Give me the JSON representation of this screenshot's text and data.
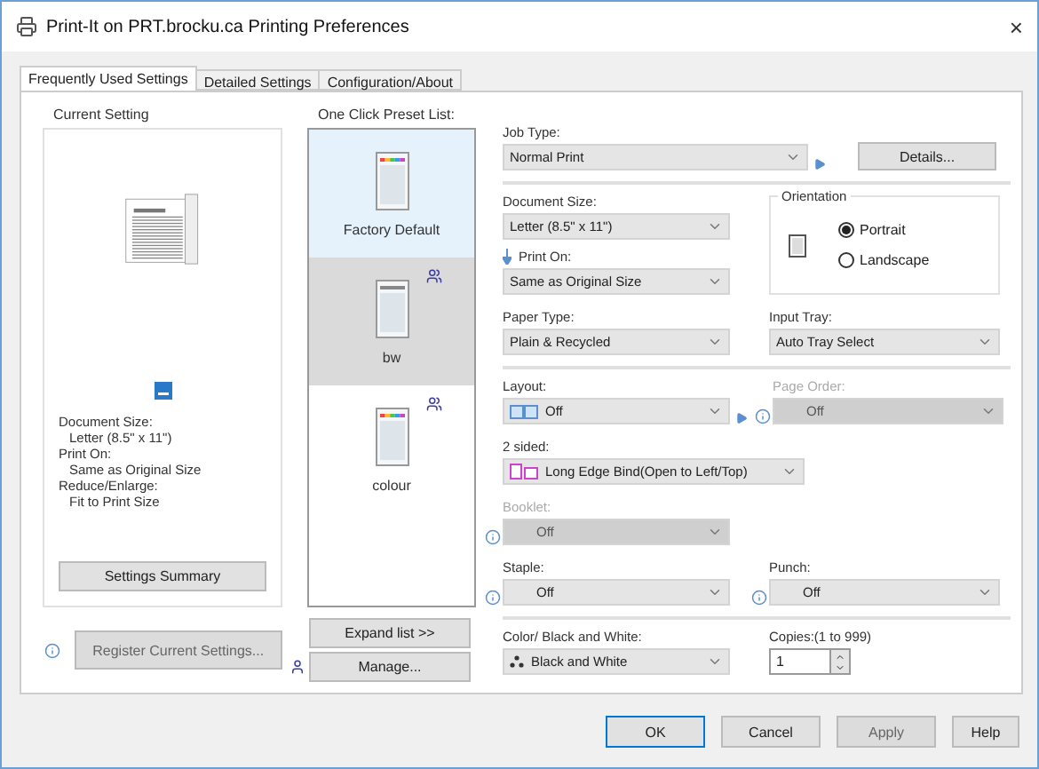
{
  "window": {
    "title": "Print-It on PRT.brocku.ca Printing Preferences",
    "close": "×"
  },
  "tabs": [
    {
      "label": "Frequently Used Settings",
      "selected": true
    },
    {
      "label": "Detailed Settings",
      "selected": false
    },
    {
      "label": "Configuration/About",
      "selected": false
    }
  ],
  "current_setting": {
    "title": "Current Setting",
    "summary": [
      {
        "heading": "Document Size:",
        "value": "Letter (8.5\" x 11\")"
      },
      {
        "heading": "Print On:",
        "value": "Same as Original Size"
      },
      {
        "heading": "Reduce/Enlarge:",
        "value": "Fit to Print Size"
      }
    ],
    "button": "Settings Summary"
  },
  "register_button": {
    "label": "Register Current Settings...",
    "disabled": true
  },
  "preset_list": {
    "title": "One Click Preset List:",
    "items": [
      {
        "label": "Factory Default",
        "selected": false,
        "hovered": true,
        "kind": "color",
        "shared": false
      },
      {
        "label": "bw",
        "selected": true,
        "hovered": false,
        "kind": "mono",
        "shared": true
      },
      {
        "label": "colour",
        "selected": false,
        "hovered": false,
        "kind": "color",
        "shared": true
      }
    ],
    "expand_button": "Expand list >>",
    "manage_button": "Manage..."
  },
  "job_type": {
    "label": "Job Type:",
    "value": "Normal Print",
    "button": "Details..."
  },
  "document_size": {
    "label": "Document Size:",
    "value": "Letter (8.5\" x 11\")"
  },
  "print_on": {
    "label": "Print On:",
    "value": "Same as Original Size"
  },
  "orientation": {
    "title": "Orientation",
    "options": [
      {
        "label": "Portrait",
        "selected": true
      },
      {
        "label": "Landscape",
        "selected": false
      }
    ]
  },
  "paper_type": {
    "label": "Paper Type:",
    "value": "Plain & Recycled"
  },
  "input_tray": {
    "label": "Input Tray:",
    "value": "Auto Tray Select"
  },
  "layout": {
    "label": "Layout:",
    "value": "Off"
  },
  "page_order": {
    "label": "Page Order:",
    "value": "Off",
    "disabled": true
  },
  "two_sided": {
    "label": "2 sided:",
    "value": "Long Edge Bind(Open to Left/Top)"
  },
  "booklet": {
    "label": "Booklet:",
    "value": "Off",
    "disabled": true
  },
  "staple": {
    "label": "Staple:",
    "value": "Off",
    "disabled": false
  },
  "punch": {
    "label": "Punch:",
    "value": "Off",
    "disabled": false
  },
  "color_mode": {
    "label": "Color/ Black and White:",
    "value": "Black and White"
  },
  "copies": {
    "label": "Copies:(1 to 999)",
    "value": "1"
  },
  "dialog_buttons": [
    {
      "label": "OK",
      "disabled": false,
      "default": true
    },
    {
      "label": "Cancel",
      "disabled": false,
      "default": false
    },
    {
      "label": "Apply",
      "disabled": true,
      "default": false
    },
    {
      "label": "Help",
      "disabled": false,
      "default": false
    }
  ]
}
